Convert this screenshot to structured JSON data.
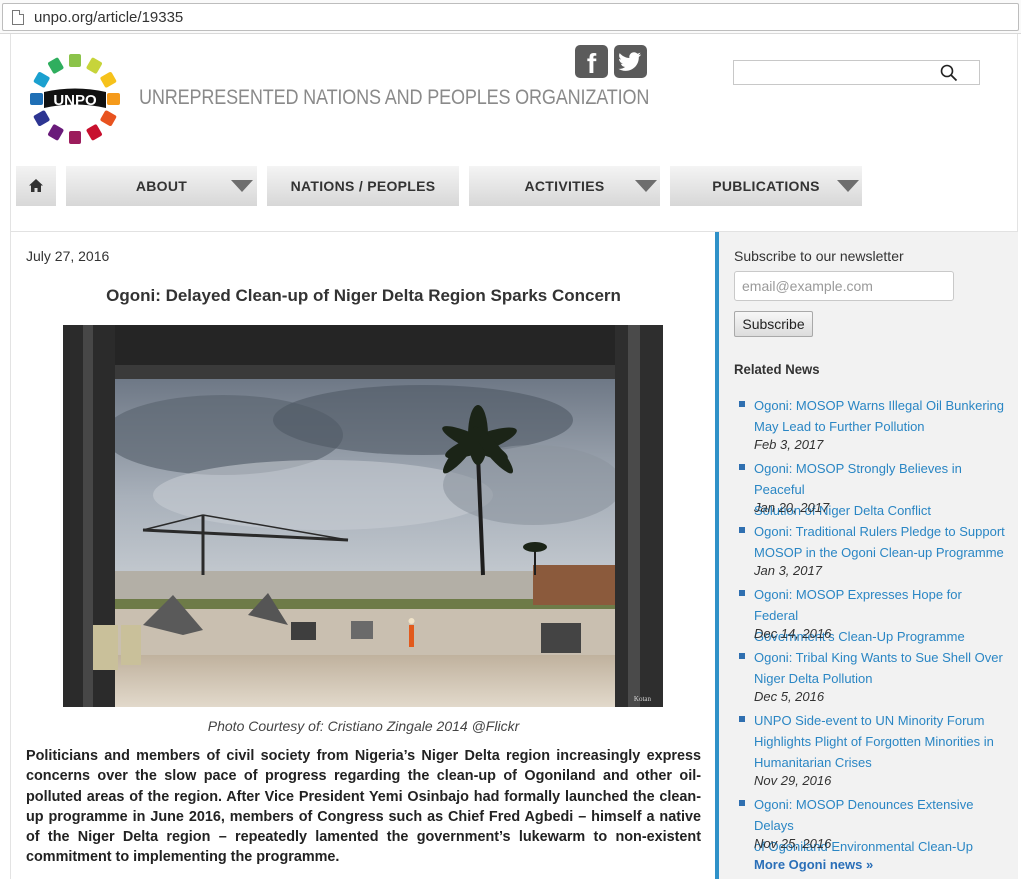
{
  "browser": {
    "url": "unpo.org/article/19335"
  },
  "header": {
    "org_name": "UNREPRESENTED NATIONS AND PEOPLES ORGANIZATION",
    "logo_text": "UNPO",
    "social": {
      "facebook_glyph": "f"
    },
    "search": {
      "placeholder": ""
    }
  },
  "nav": {
    "items": [
      {
        "label": "ABOUT"
      },
      {
        "label": "NATIONS / PEOPLES"
      },
      {
        "label": "ACTIVITIES"
      },
      {
        "label": "PUBLICATIONS"
      }
    ]
  },
  "article": {
    "date": "July 27, 2016",
    "title": "Ogoni: Delayed Clean-up of Niger Delta Region Sparks Concern",
    "caption": "Photo Courtesy of: Cristiano Zingale 2014 @Flickr",
    "photo_watermark": "Kotan",
    "body": "Politicians and members of civil society from Nigeria’s Niger Delta region increasingly express concerns over the slow pace of progress regarding the clean-up of Ogoniland and other oil-polluted areas of the region. After Vice President Yemi Osinbajo had formally launched the clean-up programme in June 2016, members of Congress such as Chief Fred Agbedi – himself a native of the Niger Delta region – repeatedly lamented the government’s lukewarm to non-existent commitment to implementing the programme."
  },
  "sidebar": {
    "newsletter_label": "Subscribe to our newsletter",
    "email_placeholder": "email@example.com",
    "subscribe_label": "Subscribe",
    "related_title": "Related News",
    "news": [
      {
        "line1": "Ogoni: MOSOP Warns Illegal Oil Bunkering",
        "line2": "May Lead to Further Pollution",
        "line3": "",
        "date": "Feb 3, 2017"
      },
      {
        "line1": "Ogoni: MOSOP Strongly Believes in Peaceful",
        "line2": "Solution of Niger Delta Conflict",
        "line3": "",
        "date": "Jan 20, 2017"
      },
      {
        "line1": "Ogoni: Traditional Rulers Pledge to Support",
        "line2": "MOSOP in the Ogoni Clean-up Programme",
        "line3": "",
        "date": "Jan 3, 2017"
      },
      {
        "line1": "Ogoni: MOSOP Expresses Hope for Federal",
        "line2": "Government’s Clean-Up Programme",
        "line3": "",
        "date": "Dec 14, 2016"
      },
      {
        "line1": "Ogoni: Tribal King Wants to Sue Shell Over",
        "line2": "Niger Delta Pollution",
        "line3": "",
        "date": "Dec 5, 2016"
      },
      {
        "line1": "UNPO Side-event to UN Minority Forum",
        "line2": "Highlights Plight of Forgotten Minorities in",
        "line3": "Humanitarian Crises",
        "date": "Nov 29, 2016"
      },
      {
        "line1": "Ogoni: MOSOP Denounces Extensive Delays",
        "line2": "of Ogoniland Environmental Clean-Up",
        "line3": "",
        "date": "Nov 25, 2016"
      }
    ],
    "more_link": "More Ogoni news »"
  },
  "colors": {
    "accent": "#2f91c8",
    "link": "#2a86c4",
    "nav_bg": "#e4e4e4"
  }
}
